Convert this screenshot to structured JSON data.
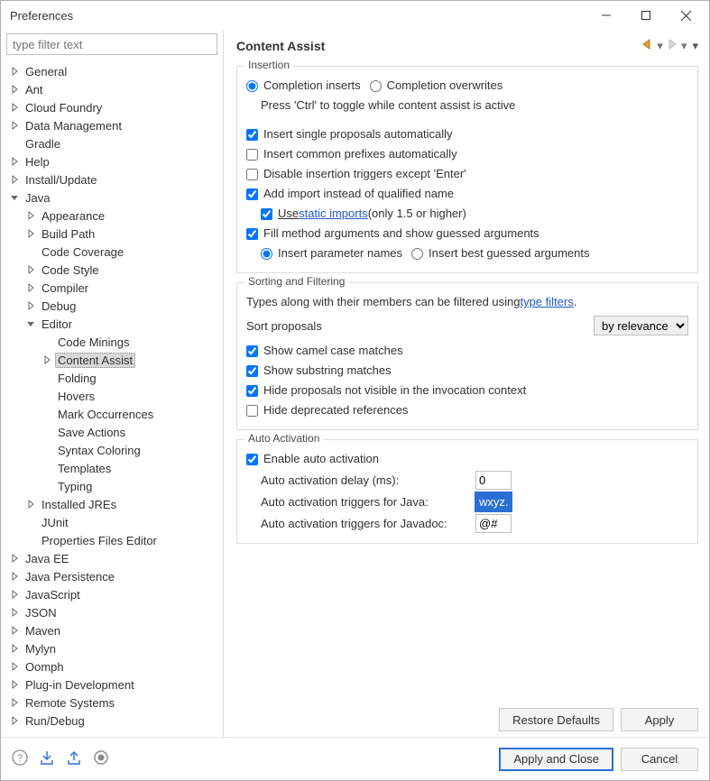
{
  "window": {
    "title": "Preferences"
  },
  "filter": {
    "placeholder": "type filter text"
  },
  "tree": [
    {
      "label": "General",
      "depth": 0,
      "twisty": "closed"
    },
    {
      "label": "Ant",
      "depth": 0,
      "twisty": "closed"
    },
    {
      "label": "Cloud Foundry",
      "depth": 0,
      "twisty": "closed"
    },
    {
      "label": "Data Management",
      "depth": 0,
      "twisty": "closed"
    },
    {
      "label": "Gradle",
      "depth": 0,
      "twisty": "none"
    },
    {
      "label": "Help",
      "depth": 0,
      "twisty": "closed"
    },
    {
      "label": "Install/Update",
      "depth": 0,
      "twisty": "closed"
    },
    {
      "label": "Java",
      "depth": 0,
      "twisty": "open"
    },
    {
      "label": "Appearance",
      "depth": 1,
      "twisty": "closed"
    },
    {
      "label": "Build Path",
      "depth": 1,
      "twisty": "closed"
    },
    {
      "label": "Code Coverage",
      "depth": 1,
      "twisty": "none"
    },
    {
      "label": "Code Style",
      "depth": 1,
      "twisty": "closed"
    },
    {
      "label": "Compiler",
      "depth": 1,
      "twisty": "closed"
    },
    {
      "label": "Debug",
      "depth": 1,
      "twisty": "closed"
    },
    {
      "label": "Editor",
      "depth": 1,
      "twisty": "open"
    },
    {
      "label": "Code Minings",
      "depth": 2,
      "twisty": "none"
    },
    {
      "label": "Content Assist",
      "depth": 2,
      "twisty": "closed",
      "selected": true
    },
    {
      "label": "Folding",
      "depth": 2,
      "twisty": "none"
    },
    {
      "label": "Hovers",
      "depth": 2,
      "twisty": "none"
    },
    {
      "label": "Mark Occurrences",
      "depth": 2,
      "twisty": "none"
    },
    {
      "label": "Save Actions",
      "depth": 2,
      "twisty": "none"
    },
    {
      "label": "Syntax Coloring",
      "depth": 2,
      "twisty": "none"
    },
    {
      "label": "Templates",
      "depth": 2,
      "twisty": "none"
    },
    {
      "label": "Typing",
      "depth": 2,
      "twisty": "none"
    },
    {
      "label": "Installed JREs",
      "depth": 1,
      "twisty": "closed"
    },
    {
      "label": "JUnit",
      "depth": 1,
      "twisty": "none"
    },
    {
      "label": "Properties Files Editor",
      "depth": 1,
      "twisty": "none"
    },
    {
      "label": "Java EE",
      "depth": 0,
      "twisty": "closed"
    },
    {
      "label": "Java Persistence",
      "depth": 0,
      "twisty": "closed"
    },
    {
      "label": "JavaScript",
      "depth": 0,
      "twisty": "closed"
    },
    {
      "label": "JSON",
      "depth": 0,
      "twisty": "closed"
    },
    {
      "label": "Maven",
      "depth": 0,
      "twisty": "closed"
    },
    {
      "label": "Mylyn",
      "depth": 0,
      "twisty": "closed"
    },
    {
      "label": "Oomph",
      "depth": 0,
      "twisty": "closed"
    },
    {
      "label": "Plug-in Development",
      "depth": 0,
      "twisty": "closed"
    },
    {
      "label": "Remote Systems",
      "depth": 0,
      "twisty": "closed"
    },
    {
      "label": "Run/Debug",
      "depth": 0,
      "twisty": "closed"
    }
  ],
  "page": {
    "title": "Content Assist",
    "insertion": {
      "legend": "Insertion",
      "radio_inserts": "Completion inserts",
      "radio_overwrites": "Completion overwrites",
      "toggle_hint": "Press 'Ctrl' to toggle while content assist is active",
      "cb_single_proposals": "Insert single proposals automatically",
      "cb_common_prefixes": "Insert common prefixes automatically",
      "cb_disable_triggers": "Disable insertion triggers except 'Enter'",
      "cb_add_import": "Add import instead of qualified name",
      "cb_use_prefix": "Use ",
      "cb_use_link": "static imports",
      "cb_use_suffix": " (only 1.5 or higher)",
      "cb_fill_method": "Fill method arguments and show guessed arguments",
      "radio_insert_params": "Insert parameter names",
      "radio_best_guess": "Insert best guessed arguments"
    },
    "sorting": {
      "legend": "Sorting and Filtering",
      "filter_hint_prefix": "Types along with their members can be filtered using ",
      "filter_hint_link": "type filters",
      "filter_hint_suffix": ".",
      "sort_label": "Sort proposals",
      "sort_value": "by relevance",
      "cb_camel": "Show camel case matches",
      "cb_substring": "Show substring matches",
      "cb_hide_not_visible": "Hide proposals not visible in the invocation context",
      "cb_hide_deprecated": "Hide deprecated references"
    },
    "auto": {
      "legend": "Auto Activation",
      "cb_enable": "Enable auto activation",
      "lbl_delay": "Auto activation delay (ms):",
      "val_delay": "0",
      "lbl_triggers_java": "Auto activation triggers for Java:",
      "val_triggers_java": "wxyz.",
      "lbl_triggers_javadoc": "Auto activation triggers for Javadoc:",
      "val_triggers_javadoc": "@#"
    },
    "buttons": {
      "restore": "Restore Defaults",
      "apply": "Apply",
      "apply_close": "Apply and Close",
      "cancel": "Cancel"
    }
  }
}
